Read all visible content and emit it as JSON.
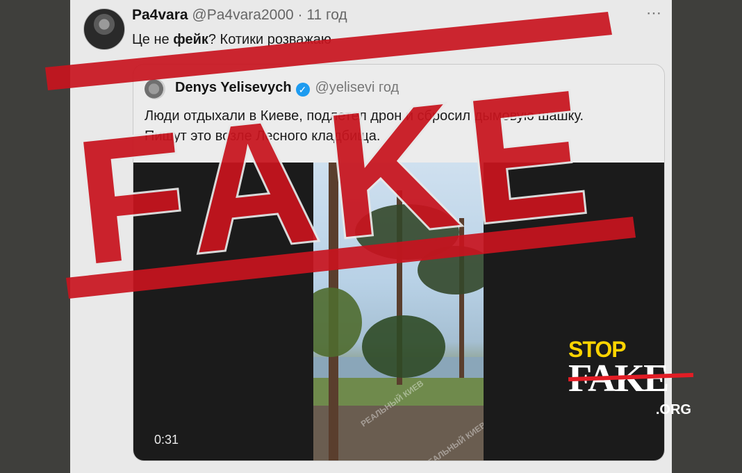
{
  "tweet": {
    "display_name": "Pa4vara",
    "handle": "@Pa4vara2000",
    "separator": "·",
    "time": "11 год",
    "more_icon": "⋯",
    "text_before": "Це не ",
    "text_bold": "фейк",
    "text_after": "? Котики розважаю"
  },
  "quote": {
    "display_name": "Denys Yelisevych",
    "verified_icon": "✓",
    "handle": "@yelisevi",
    "time": "год",
    "text_line1": "Люди отдыхали в Киеве, подлетел дрон и сбросил дымовую шашку.",
    "text_line2": "Пишут это возле Лесного кладбища."
  },
  "video": {
    "duration": "0:31",
    "watermark": "РЕАЛЬНЫЙ КИЕВ"
  },
  "stamp": {
    "text": "FAKE",
    "color": "#c8141e"
  },
  "logo": {
    "stop": "STOP",
    "fake": "FAKE",
    "org": ".ORG",
    "stop_color": "#ffd400",
    "strike_color": "#e21d25"
  }
}
